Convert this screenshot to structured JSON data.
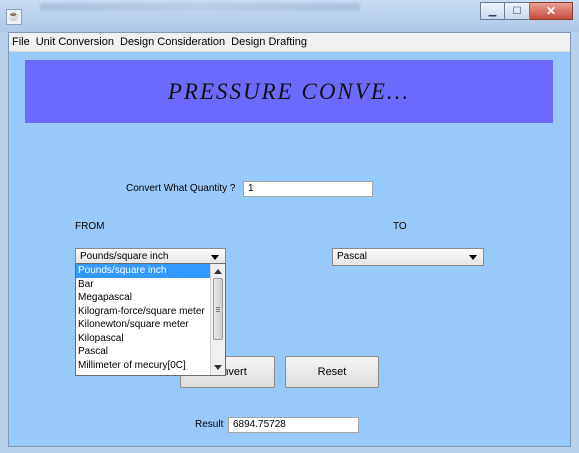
{
  "menubar": {
    "items": [
      "File",
      "Unit Conversion",
      "Design Consideration",
      "Design Drafting"
    ]
  },
  "window_controls": {
    "minimize_icon": "minimize-icon",
    "maximize_icon": "maximize-icon",
    "close_icon": "close-icon"
  },
  "banner": {
    "title": "PRESSURE  CONVE..."
  },
  "form": {
    "quantity_label": "Convert What Quantity ?",
    "quantity_value": "1",
    "from_label": "FROM",
    "to_label": "TO",
    "from_selected": "Pounds/square inch",
    "to_selected": "Pascal",
    "from_options": [
      "Pounds/square inch",
      "Bar",
      "Megapascal",
      "Kilogram-force/square meter",
      "Kilonewton/square meter",
      "Kilopascal",
      "Pascal",
      "Millimeter of mecury[0C]"
    ],
    "convert_label": "Convert",
    "reset_label": "Reset",
    "result_label": "Result",
    "result_value": "6894.75728"
  },
  "colors": {
    "panel_bg": "#97c9fb",
    "banner_bg": "#6c6bfe",
    "selection": "#3399ff"
  }
}
